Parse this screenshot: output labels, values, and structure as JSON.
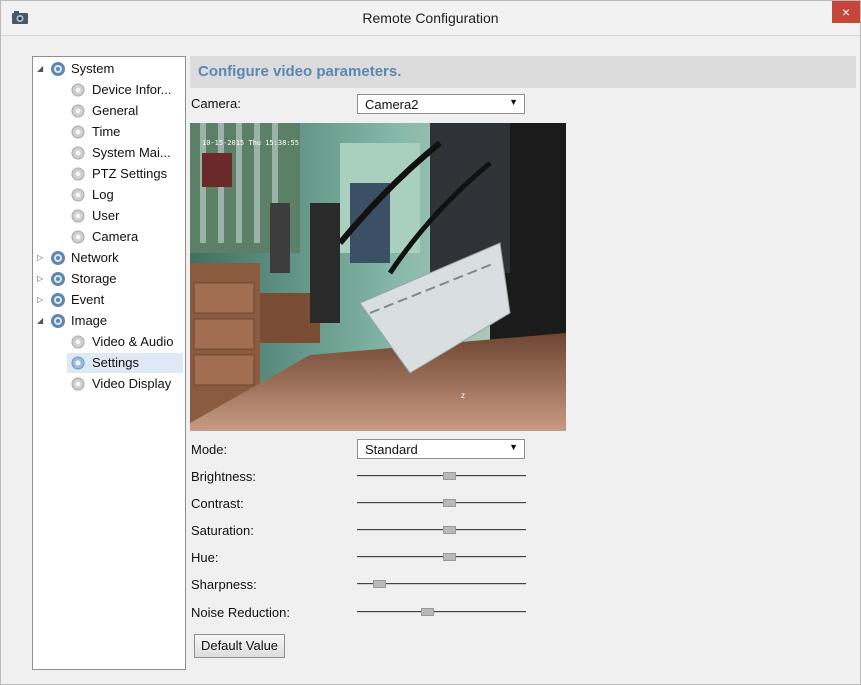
{
  "window": {
    "title": "Remote Configuration",
    "close_glyph": "×",
    "app_icon": "camera-app-icon"
  },
  "tree": {
    "items": [
      {
        "label": "System",
        "type": "group",
        "state": "expanded"
      },
      {
        "label": "Device Infor...",
        "type": "leaf"
      },
      {
        "label": "General",
        "type": "leaf"
      },
      {
        "label": "Time",
        "type": "leaf"
      },
      {
        "label": "System Mai...",
        "type": "leaf"
      },
      {
        "label": "PTZ Settings",
        "type": "leaf"
      },
      {
        "label": "Log",
        "type": "leaf"
      },
      {
        "label": "User",
        "type": "leaf"
      },
      {
        "label": "Camera",
        "type": "leaf"
      },
      {
        "label": "Network",
        "type": "group",
        "state": "collapsed"
      },
      {
        "label": "Storage",
        "type": "group",
        "state": "collapsed"
      },
      {
        "label": "Event",
        "type": "group",
        "state": "collapsed"
      },
      {
        "label": "Image",
        "type": "group",
        "state": "expanded"
      },
      {
        "label": "Video & Audio",
        "type": "leaf"
      },
      {
        "label": "Settings",
        "type": "leaf",
        "selected": true
      },
      {
        "label": "Video Display",
        "type": "leaf"
      }
    ],
    "expanded_glyph": "◢",
    "collapsed_glyph": "▷"
  },
  "main": {
    "header": "Configure video parameters.",
    "camera": {
      "label": "Camera:",
      "value": "Camera2"
    },
    "mode": {
      "label": "Mode:",
      "value": "Standard"
    },
    "dropdown_glyph": "▼",
    "video_overlay": {
      "timestamp": "10-15-2015 Thu 15:38:55",
      "channel_mark": "z"
    },
    "sliders": [
      {
        "label": "Brightness:",
        "value": 0.55
      },
      {
        "label": "Contrast:",
        "value": 0.55
      },
      {
        "label": "Saturation:",
        "value": 0.55
      },
      {
        "label": "Hue:",
        "value": 0.55
      },
      {
        "label": "Sharpness:",
        "value": 0.1
      },
      {
        "label": "Noise Reduction:",
        "value": 0.41
      }
    ],
    "default_button": "Default Value"
  },
  "colors": {
    "header_text": "#5a87b6",
    "header_bg": "#dcdcdc",
    "close_bg": "#c7463b",
    "selection": "#dfe9f5"
  }
}
